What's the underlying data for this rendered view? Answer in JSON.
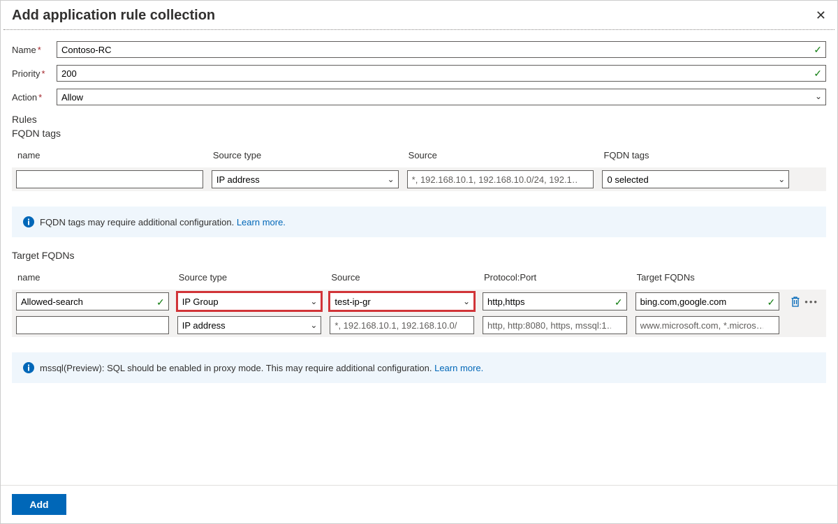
{
  "title": "Add application rule collection",
  "fields": {
    "name_label": "Name",
    "name_value": "Contoso-RC",
    "priority_label": "Priority",
    "priority_value": "200",
    "action_label": "Action",
    "action_value": "Allow"
  },
  "rules_heading": "Rules",
  "fqdn_tags": {
    "heading": "FQDN tags",
    "columns": {
      "name": "name",
      "source_type": "Source type",
      "source": "Source",
      "tags": "FQDN tags"
    },
    "row": {
      "name": "",
      "source_type": "IP address",
      "source_placeholder": "*, 192.168.10.1, 192.168.10.0/24, 192.1…",
      "tags": "0 selected"
    },
    "info_text": "FQDN tags may require additional configuration.",
    "info_link": "Learn more."
  },
  "target_fqdns": {
    "heading": "Target FQDNs",
    "columns": {
      "name": "name",
      "source_type": "Source type",
      "source": "Source",
      "protocol": "Protocol:Port",
      "target": "Target FQDNs"
    },
    "rows": [
      {
        "name": "Allowed-search",
        "source_type": "IP Group",
        "source": "test-ip-gr",
        "protocol": "http,https",
        "target": "bing.com,google.com"
      },
      {
        "name": "",
        "source_type": "IP address",
        "source_placeholder": "*, 192.168.10.1, 192.168.10.0/…",
        "protocol_placeholder": "http, http:8080, https, mssql:1…",
        "target_placeholder": "www.microsoft.com, *.micros…"
      }
    ],
    "info_text": "mssql(Preview): SQL should be enabled in proxy mode. This may require additional configuration.",
    "info_link": "Learn more."
  },
  "footer": {
    "add_label": "Add"
  }
}
